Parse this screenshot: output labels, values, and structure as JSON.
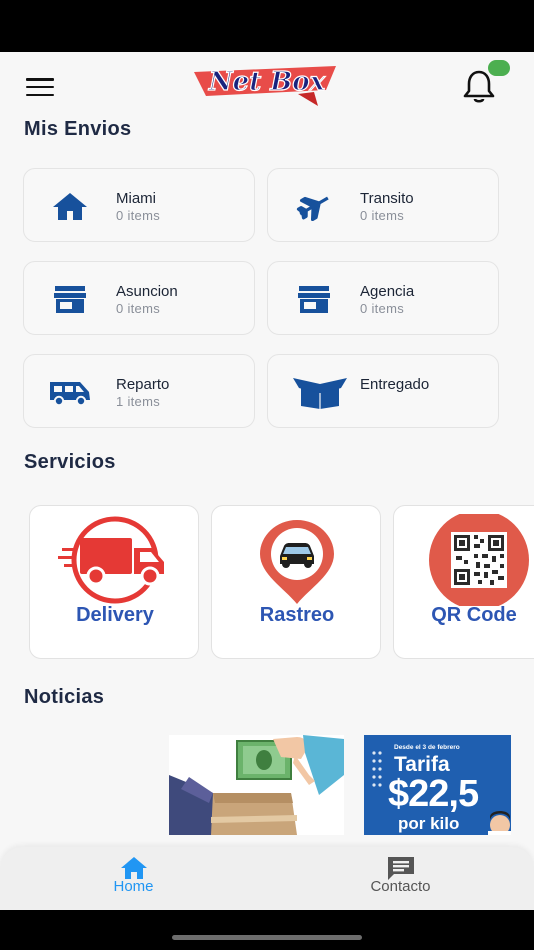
{
  "header": {
    "logo_text": "Net Box",
    "notification_dot_color": "#4caf50"
  },
  "envios": {
    "title": "Mis Envios",
    "items": [
      {
        "name": "Miami",
        "count": "0 items",
        "icon": "home-icon"
      },
      {
        "name": "Transito",
        "count": "0 items",
        "icon": "airplane-icon"
      },
      {
        "name": "Asuncion",
        "count": "0 items",
        "icon": "store-icon"
      },
      {
        "name": "Agencia",
        "count": "0 items",
        "icon": "store-icon"
      },
      {
        "name": "Reparto",
        "count": "1 items",
        "icon": "van-icon"
      },
      {
        "name": "Entregado",
        "count": "",
        "icon": "open-box-icon"
      }
    ]
  },
  "servicios": {
    "title": "Servicios",
    "items": [
      {
        "label": "Delivery",
        "icon": "delivery-truck-icon"
      },
      {
        "label": "Rastreo",
        "icon": "tracking-pin-icon"
      },
      {
        "label": "QR Code",
        "icon": "qr-code-icon"
      }
    ]
  },
  "noticias": {
    "title": "Noticias",
    "promo": {
      "top": "Desde el 3 de febrero",
      "title": "Tarifa",
      "price": "$22,5",
      "unit": "por kilo"
    }
  },
  "nav": {
    "items": [
      {
        "label": "Home",
        "icon": "home-icon",
        "active": true
      },
      {
        "label": "Contacto",
        "icon": "chat-icon",
        "active": false
      }
    ]
  },
  "colors": {
    "brand_blue": "#17519c",
    "nav_active": "#2196f3",
    "nav_inactive": "#555555",
    "service_text": "#2d56b3",
    "accent_red": "#e53935"
  }
}
